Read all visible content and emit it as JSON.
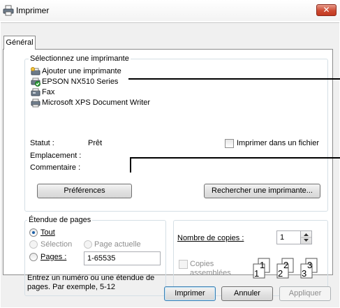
{
  "window": {
    "title": "Imprimer",
    "close_glyph": "✕"
  },
  "tabs": [
    "Général"
  ],
  "printer_group": {
    "legend": "Sélectionnez une imprimante",
    "items": [
      {
        "label": "Ajouter une imprimante",
        "icon": "add-printer-icon"
      },
      {
        "label": "EPSON NX510 Series",
        "icon": "default-printer-icon",
        "default": true
      },
      {
        "label": "Fax",
        "icon": "fax-icon"
      },
      {
        "label": "Microsoft XPS Document Writer",
        "icon": "printer-icon"
      }
    ],
    "status_label": "Statut :",
    "status_value": "Prêt",
    "location_label": "Emplacement :",
    "comment_label": "Commentaire :",
    "print_to_file_label": "Imprimer dans un fichier",
    "preferences_button": "Préférences",
    "find_printer_button": "Rechercher une imprimante..."
  },
  "page_range": {
    "legend": "Étendue de pages",
    "all_label": "Tout",
    "selection_label": "Sélection",
    "current_page_label": "Page actuelle",
    "pages_label": "Pages :",
    "pages_value": "1-65535",
    "help_text": "Entrez un numéro ou une étendue de pages. Par exemple, 5-12",
    "selected": "all"
  },
  "copies": {
    "number_label": "Nombre de copies :",
    "number_value": "1",
    "collate_label_1": "Copies",
    "collate_label_2": "assemblées",
    "collate_icon": "collate-pages-icon",
    "collate_pages": [
      "1",
      "1",
      "2",
      "2",
      "3",
      "3"
    ]
  },
  "buttons": {
    "print": "Imprimer",
    "cancel": "Annuler",
    "apply": "Appliquer"
  },
  "colors": {
    "close_button": "#c3391f",
    "panel_bg": "#f0f0f0",
    "focus_border": "#3c7fb1"
  }
}
